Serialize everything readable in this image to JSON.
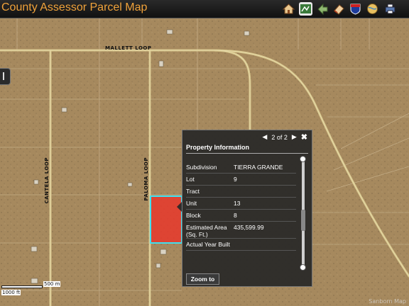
{
  "app": {
    "title": "County Assessor Parcel Map"
  },
  "toolbar": {
    "tools": [
      {
        "icon": "home-icon"
      },
      {
        "icon": "map-icon"
      },
      {
        "icon": "arrow-back-icon"
      },
      {
        "icon": "eraser-icon"
      },
      {
        "icon": "interstate-shield-icon"
      },
      {
        "icon": "globe-icon"
      },
      {
        "icon": "printer-icon"
      }
    ]
  },
  "map": {
    "road_labels": {
      "mallett": "MALLETT LOOP",
      "paloma": "PALOMA LOOP",
      "cantela": "CANTELA LOOP"
    },
    "scale": {
      "label_m": "500 m",
      "label_ft": "1000 ft"
    },
    "attribution": "Sanborn Map",
    "selected_parcel_color": "#e8382c"
  },
  "popup": {
    "pager": {
      "prev": "◀",
      "text": "2 of 2",
      "next": "▶",
      "close": "✖"
    },
    "title": "Property Information",
    "rows": [
      {
        "key": "Subdivision",
        "value": "TIERRA GRANDE"
      },
      {
        "key": "Lot",
        "value": "9"
      },
      {
        "key": "Tract",
        "value": ""
      },
      {
        "key": "Unit",
        "value": "13"
      },
      {
        "key": "Block",
        "value": "8"
      },
      {
        "key": "Estimated Area (Sq. Ft.)",
        "value": "435,599.99"
      },
      {
        "key": "Actual Year Built",
        "value": ""
      }
    ],
    "zoom_label": "Zoom to"
  }
}
